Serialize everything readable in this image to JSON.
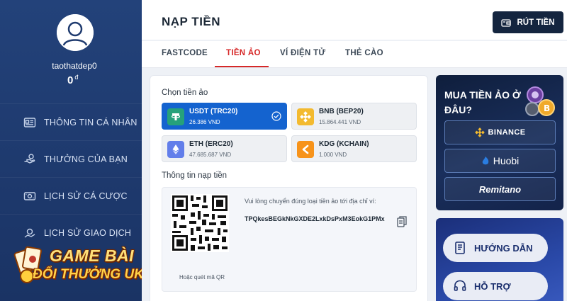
{
  "user": {
    "name": "taothatdep0",
    "balance": "0",
    "currency": "đ"
  },
  "sidebar": {
    "items": [
      {
        "label": "THÔNG TIN CÁ NHÂN",
        "icon": "profile-card-icon"
      },
      {
        "label": "THƯỞNG CỦA BẠN",
        "icon": "reward-hand-icon"
      },
      {
        "label": "LỊCH SỬ CÁ CƯỢC",
        "icon": "bet-history-icon"
      },
      {
        "label": "LỊCH SỬ GIAO DỊCH",
        "icon": "transaction-history-icon"
      }
    ]
  },
  "logo": {
    "line1": "GAME BÀI",
    "line2": "ĐỔI THƯỞNG UK"
  },
  "header": {
    "title": "NẠP TIỀN",
    "withdraw_label": "RÚT TIỀN"
  },
  "tabs": [
    {
      "label": "FASTCODE",
      "active": false
    },
    {
      "label": "TIỀN ẢO",
      "active": true
    },
    {
      "label": "VÍ ĐIỆN TỬ",
      "active": false
    },
    {
      "label": "THẺ CÀO",
      "active": false
    }
  ],
  "crypto": {
    "choose_label": "Chọn tiền ảo",
    "coins": [
      {
        "name": "USDT (TRC20)",
        "rate": "26.386 VND",
        "selected": true,
        "color": "#26a17b"
      },
      {
        "name": "BNB (BEP20)",
        "rate": "15.864.441 VND",
        "selected": false,
        "color": "#f3ba2f"
      },
      {
        "name": "ETH (ERC20)",
        "rate": "47.685.687 VND",
        "selected": false,
        "color": "#627eea"
      },
      {
        "name": "KDG (KCHAIN)",
        "rate": "1.000 VND",
        "selected": false,
        "color": "#f7931a"
      }
    ]
  },
  "deposit": {
    "info_label": "Thông tin nạp tiền",
    "instruction": "Vui lòng chuyển đúng loại tiền ảo tới địa chỉ ví:",
    "address": "TPQkesBEGkNkGXDE2LxkDsPxM3EokG1PMx",
    "qr_caption": "Hoặc quét mã QR"
  },
  "buy": {
    "title": "MUA TIỀN ẢO Ở ĐÂU?",
    "exchanges": [
      "BINANCE",
      "Huobi",
      "Remitano"
    ]
  },
  "help": {
    "guide_label": "HƯỚNG DẪN",
    "support_label": "HỖ TRỢ"
  },
  "colors": {
    "sidebar": "#1e3a6e",
    "accent_red": "#d62828",
    "selected_blue": "#1463cf",
    "button_dark": "#14253f"
  }
}
